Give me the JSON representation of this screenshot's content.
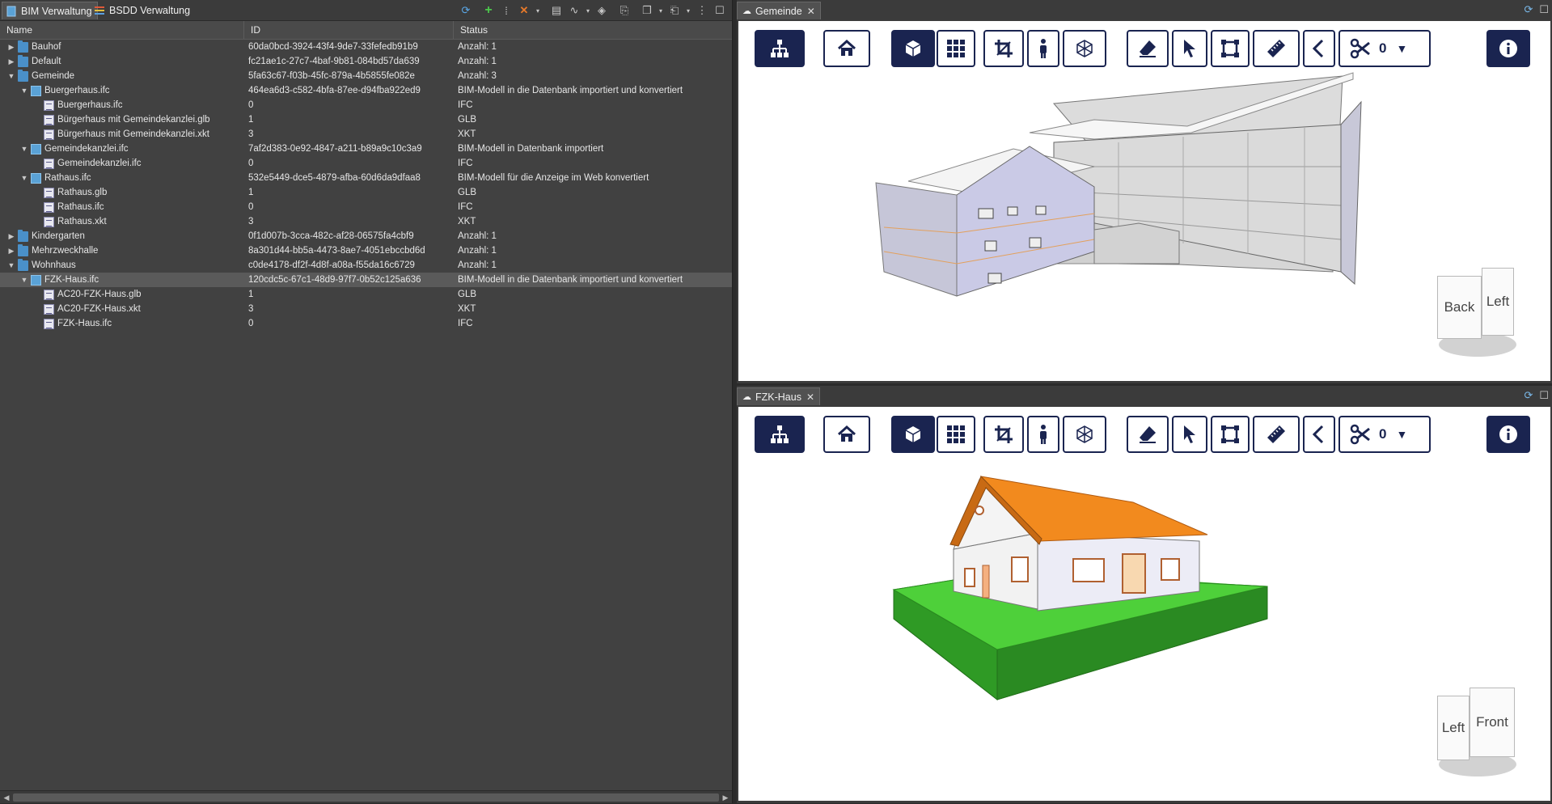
{
  "left_panel": {
    "tabs": [
      {
        "label": "BIM Verwaltung",
        "active": true
      },
      {
        "label": "BSDD Verwaltung",
        "active": false
      }
    ],
    "columns": {
      "name": "Name",
      "id": "ID",
      "status": "Status"
    },
    "rows": [
      {
        "level": 0,
        "toggle": "collapsed",
        "icon": "folder",
        "name": "Bauhof",
        "id": "60da0bcd-3924-43f4-9de7-33fefedb91b9",
        "status": "Anzahl: 1"
      },
      {
        "level": 0,
        "toggle": "collapsed",
        "icon": "folder",
        "name": "Default",
        "id": "fc21ae1c-27c7-4baf-9b81-084bd57da639",
        "status": "Anzahl: 1"
      },
      {
        "level": 0,
        "toggle": "expanded",
        "icon": "folder",
        "name": "Gemeinde",
        "id": "5fa63c67-f03b-45fc-879a-4b5855fe082e",
        "status": "Anzahl: 3"
      },
      {
        "level": 1,
        "toggle": "expanded",
        "icon": "model",
        "name": "Buergerhaus.ifc",
        "id": "464ea6d3-c582-4bfa-87ee-d94fba922ed9",
        "status": "BIM-Modell in die Datenbank importiert und konvertiert"
      },
      {
        "level": 2,
        "toggle": "none",
        "icon": "file",
        "name": "Buergerhaus.ifc",
        "id": "0",
        "status": "IFC"
      },
      {
        "level": 2,
        "toggle": "none",
        "icon": "file",
        "name": "Bürgerhaus mit Gemeindekanzlei.glb",
        "id": "1",
        "status": "GLB"
      },
      {
        "level": 2,
        "toggle": "none",
        "icon": "file",
        "name": "Bürgerhaus mit Gemeindekanzlei.xkt",
        "id": "3",
        "status": "XKT"
      },
      {
        "level": 1,
        "toggle": "expanded",
        "icon": "model",
        "name": "Gemeindekanzlei.ifc",
        "id": "7af2d383-0e92-4847-a211-b89a9c10c3a9",
        "status": "BIM-Modell in Datenbank importiert"
      },
      {
        "level": 2,
        "toggle": "none",
        "icon": "file",
        "name": "Gemeindekanzlei.ifc",
        "id": "0",
        "status": "IFC"
      },
      {
        "level": 1,
        "toggle": "expanded",
        "icon": "model",
        "name": "Rathaus.ifc",
        "id": "532e5449-dce5-4879-afba-60d6da9dfaa8",
        "status": "BIM-Modell für die Anzeige im Web konvertiert"
      },
      {
        "level": 2,
        "toggle": "none",
        "icon": "file",
        "name": "Rathaus.glb",
        "id": "1",
        "status": "GLB"
      },
      {
        "level": 2,
        "toggle": "none",
        "icon": "file",
        "name": "Rathaus.ifc",
        "id": "0",
        "status": "IFC"
      },
      {
        "level": 2,
        "toggle": "none",
        "icon": "file",
        "name": "Rathaus.xkt",
        "id": "3",
        "status": "XKT"
      },
      {
        "level": 0,
        "toggle": "collapsed",
        "icon": "folder",
        "name": "Kindergarten",
        "id": "0f1d007b-3cca-482c-af28-06575fa4cbf9",
        "status": "Anzahl: 1"
      },
      {
        "level": 0,
        "toggle": "collapsed",
        "icon": "folder",
        "name": "Mehrzweckhalle",
        "id": "8a301d44-bb5a-4473-8ae7-4051ebccbd6d",
        "status": "Anzahl: 1"
      },
      {
        "level": 0,
        "toggle": "expanded",
        "icon": "folder",
        "name": "Wohnhaus",
        "id": "c0de4178-df2f-4d8f-a08a-f55da16c6729",
        "status": "Anzahl: 1"
      },
      {
        "level": 1,
        "toggle": "expanded",
        "icon": "model",
        "name": "FZK-Haus.ifc",
        "id": "120cdc5c-67c1-48d9-97f7-0b52c125a636",
        "status": "BIM-Modell in die Datenbank importiert und konvertiert",
        "selected": true
      },
      {
        "level": 2,
        "toggle": "none",
        "icon": "file",
        "name": "AC20-FZK-Haus.glb",
        "id": "1",
        "status": "GLB"
      },
      {
        "level": 2,
        "toggle": "none",
        "icon": "file",
        "name": "AC20-FZK-Haus.xkt",
        "id": "3",
        "status": "XKT"
      },
      {
        "level": 2,
        "toggle": "none",
        "icon": "file",
        "name": "FZK-Haus.ifc",
        "id": "0",
        "status": "IFC"
      }
    ]
  },
  "viewer_top": {
    "tab_title": "Gemeinde",
    "section_count": "0",
    "navcube": {
      "face_a": "Back",
      "face_b": "Left"
    }
  },
  "viewer_bottom": {
    "tab_title": "FZK-Haus",
    "section_count": "0",
    "navcube": {
      "face_a": "Left",
      "face_b": "Front"
    }
  },
  "colors": {
    "toolbar_navy": "#1a2450",
    "roof_orange": "#f28a1e",
    "ground_green": "#44c832"
  },
  "icons": [
    "tree-icon",
    "home-icon",
    "cube-icon",
    "grid-icon",
    "crop-icon",
    "person-icon",
    "xray-icon",
    "eraser-icon",
    "pointer-icon",
    "select-box-icon",
    "ruler-icon",
    "back-icon",
    "scissors-icon",
    "info-icon"
  ]
}
